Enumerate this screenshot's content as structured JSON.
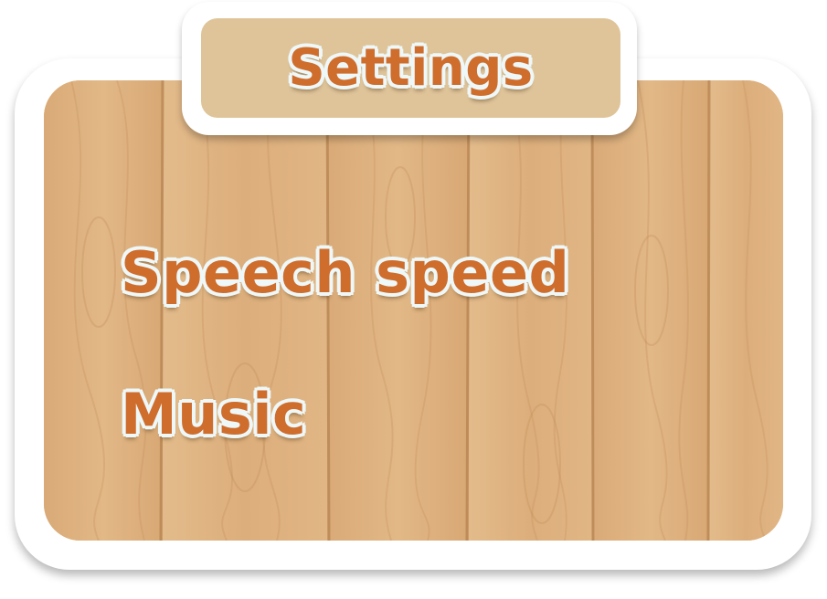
{
  "settings_panel": {
    "title": "Settings",
    "options": [
      {
        "label": "Speech speed"
      },
      {
        "label": "Music"
      }
    ]
  },
  "colors": {
    "label_text": "#cf6d2d",
    "label_outline": "#eef8f8",
    "wood_base": "#deb281",
    "title_tab_fill": "#dfc49a",
    "frame": "#ffffff"
  }
}
